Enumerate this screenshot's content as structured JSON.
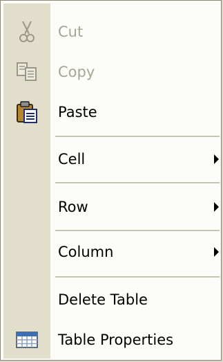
{
  "menu": {
    "items": [
      {
        "label": "Cut",
        "icon": "scissors-icon",
        "enabled": false
      },
      {
        "label": "Copy",
        "icon": "copy-icon",
        "enabled": false
      },
      {
        "label": "Paste",
        "icon": "paste-icon",
        "enabled": true
      },
      {
        "label": "Cell",
        "submenu": true,
        "enabled": true
      },
      {
        "label": "Row",
        "submenu": true,
        "enabled": true
      },
      {
        "label": "Column",
        "submenu": true,
        "enabled": true
      },
      {
        "label": "Delete Table",
        "enabled": true
      },
      {
        "label": "Table Properties",
        "icon": "table-properties-icon",
        "enabled": true
      }
    ]
  },
  "colors": {
    "menu_background": "#fcfcf9",
    "icon_gutter": "#e1dfcc",
    "disabled_text": "#a7a596",
    "separator": "#c5c2b2",
    "border": "#8a8776"
  }
}
